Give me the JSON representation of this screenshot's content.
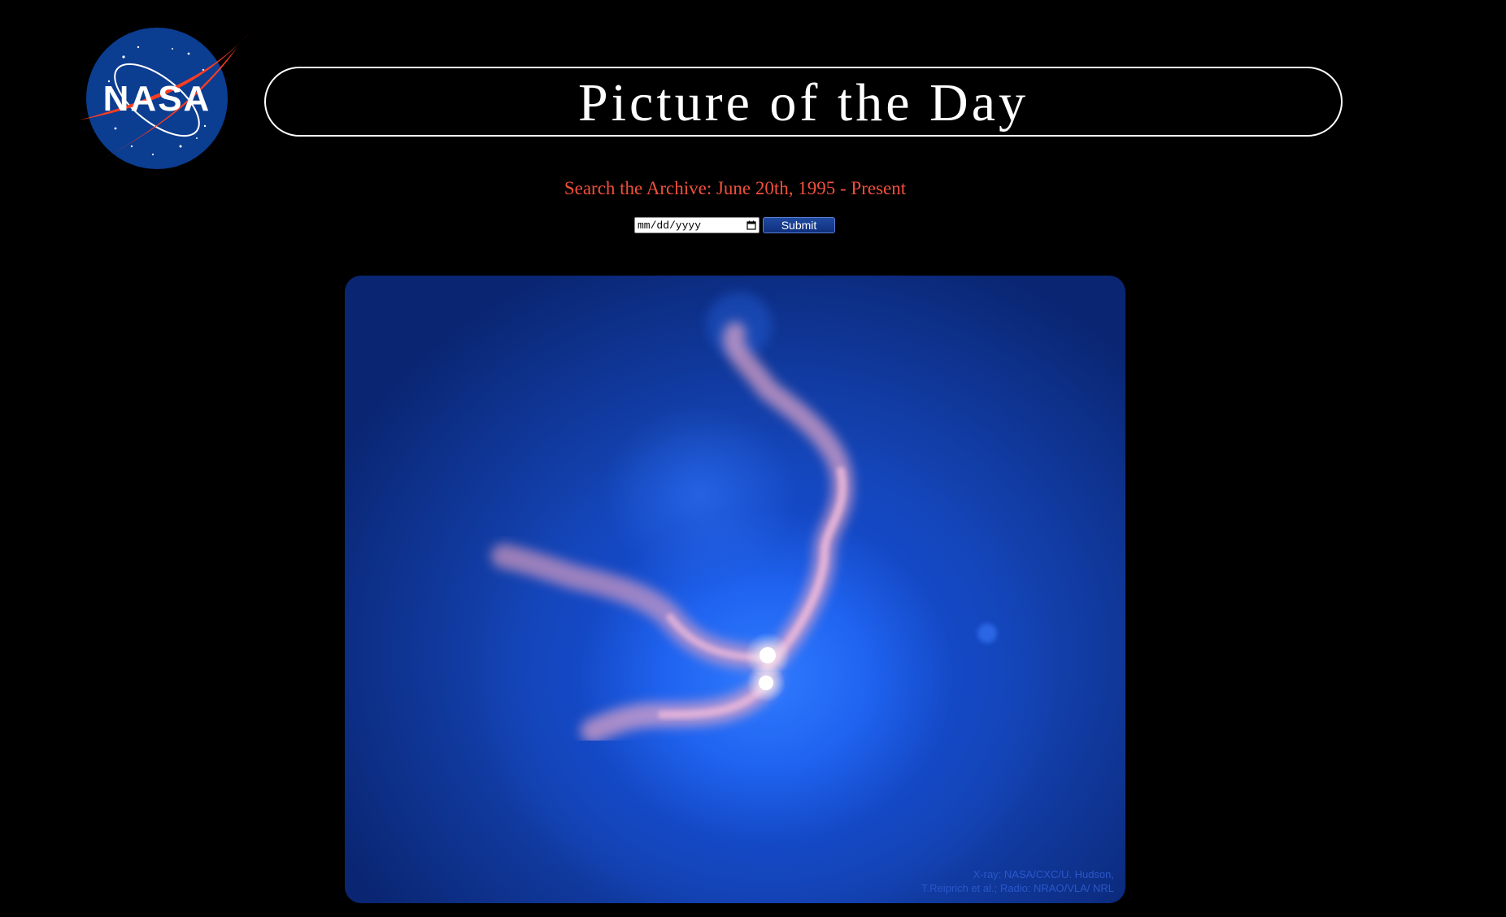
{
  "header": {
    "logo_text": "NASA",
    "title": "Picture of the Day"
  },
  "search": {
    "caption": "Search the Archive: June 20th, 1995 - Present",
    "date_placeholder": "mm/dd/yyyy",
    "submit_label": "Submit"
  },
  "image": {
    "credit_line1": "X-ray: NASA/CXC/U. Hudson,",
    "credit_line2": "T.Reiprich et al.; Radio: NRAO/VLA/ NRL"
  },
  "colors": {
    "background": "#000000",
    "caption": "#f0503a",
    "title_text": "#ffffff",
    "button": "#1a3f94",
    "logo_blue": "#0b3d91",
    "logo_red": "#fc3d21"
  },
  "icons": [
    "nasa-logo",
    "calendar-icon"
  ]
}
